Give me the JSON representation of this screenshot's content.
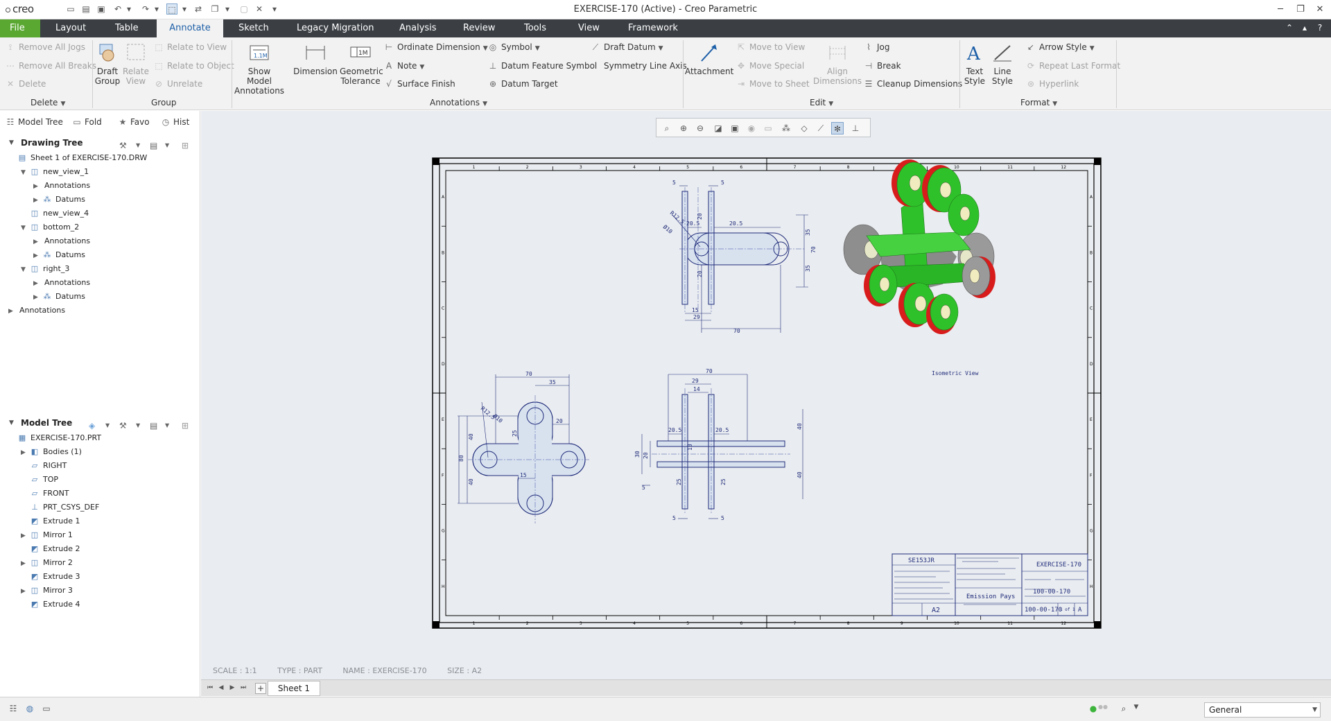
{
  "app": {
    "title": "EXERCISE-170 (Active) - Creo Parametric",
    "logo": "creo"
  },
  "menu": [
    {
      "label": "File",
      "name": "file"
    },
    {
      "label": "Layout",
      "name": "layout"
    },
    {
      "label": "Table",
      "name": "table"
    },
    {
      "label": "Annotate",
      "name": "annotate"
    },
    {
      "label": "Sketch",
      "name": "sketch"
    },
    {
      "label": "Legacy Migration",
      "name": "legacy-migration"
    },
    {
      "label": "Analysis",
      "name": "analysis"
    },
    {
      "label": "Review",
      "name": "review"
    },
    {
      "label": "Tools",
      "name": "tools"
    },
    {
      "label": "View",
      "name": "view"
    },
    {
      "label": "Framework",
      "name": "framework"
    }
  ],
  "ribbon": {
    "delete_group": {
      "remove_all_jogs": "Remove All Jogs",
      "remove_all_breaks": "Remove All Breaks",
      "delete": "Delete",
      "label": "Delete"
    },
    "group_group": {
      "draft_group": "Draft Group",
      "relate_view": "Relate View",
      "relate_to_view": "Relate to View",
      "relate_to_object": "Relate to Object",
      "unrelate": "Unrelate",
      "label": "Group"
    },
    "annotations_group": {
      "show_model_annotations": "Show Model Annotations",
      "dimension": "Dimension",
      "geometric_tolerance": "Geometric Tolerance",
      "ordinate_dimension": "Ordinate Dimension",
      "note": "Note",
      "surface_finish": "Surface Finish",
      "symbol": "Symbol",
      "datum_feature_symbol": "Datum Feature Symbol",
      "datum_target": "Datum Target",
      "draft_datum": "Draft Datum",
      "symmetry_line_axis": "Symmetry Line Axis",
      "label": "Annotations"
    },
    "edit_group": {
      "attachment": "Attachment",
      "move_to_view": "Move to View",
      "move_special": "Move Special",
      "move_to_sheet": "Move to Sheet",
      "align_dimensions": "Align Dimensions",
      "jog": "Jog",
      "break": "Break",
      "cleanup_dimensions": "Cleanup Dimensions",
      "label": "Edit"
    },
    "format_group": {
      "text_style": "Text Style",
      "line_style": "Line Style",
      "arrow_style": "Arrow Style",
      "repeat_last_format": "Repeat Last Format",
      "hyperlink": "Hyperlink",
      "label": "Format"
    }
  },
  "panel_tabs": [
    {
      "label": "Model Tree",
      "icon": "model-tree-icon"
    },
    {
      "label": "Fold",
      "icon": "folder-icon"
    },
    {
      "label": "Favo",
      "icon": "favorites-icon"
    },
    {
      "label": "Hist",
      "icon": "history-icon"
    }
  ],
  "drawing_tree": {
    "title": "Drawing Tree",
    "items": [
      {
        "label": "Sheet 1 of EXERCISE-170.DRW",
        "indent": 0,
        "toggle": "",
        "icon": "sheet-icon"
      },
      {
        "label": "new_view_1",
        "indent": 1,
        "toggle": "▼",
        "icon": "view-icon"
      },
      {
        "label": "Annotations",
        "indent": 2,
        "toggle": "▶",
        "icon": ""
      },
      {
        "label": "Datums",
        "indent": 2,
        "toggle": "▶",
        "icon": "datum-icon"
      },
      {
        "label": "new_view_4",
        "indent": 1,
        "toggle": "",
        "icon": "view-icon"
      },
      {
        "label": "bottom_2",
        "indent": 1,
        "toggle": "▼",
        "icon": "view-icon"
      },
      {
        "label": "Annotations",
        "indent": 2,
        "toggle": "▶",
        "icon": ""
      },
      {
        "label": "Datums",
        "indent": 2,
        "toggle": "▶",
        "icon": "datum-icon"
      },
      {
        "label": "right_3",
        "indent": 1,
        "toggle": "▼",
        "icon": "view-icon"
      },
      {
        "label": "Annotations",
        "indent": 2,
        "toggle": "▶",
        "icon": ""
      },
      {
        "label": "Datums",
        "indent": 2,
        "toggle": "▶",
        "icon": "datum-icon"
      },
      {
        "label": "Annotations",
        "indent": 0,
        "toggle": "▶",
        "icon": ""
      }
    ]
  },
  "model_tree": {
    "title": "Model Tree",
    "items": [
      {
        "label": "EXERCISE-170.PRT",
        "indent": 0,
        "toggle": "",
        "icon": "part-icon"
      },
      {
        "label": "Bodies (1)",
        "indent": 1,
        "toggle": "▶",
        "icon": "bodies-icon"
      },
      {
        "label": "RIGHT",
        "indent": 1,
        "toggle": "",
        "icon": "plane-icon"
      },
      {
        "label": "TOP",
        "indent": 1,
        "toggle": "",
        "icon": "plane-icon"
      },
      {
        "label": "FRONT",
        "indent": 1,
        "toggle": "",
        "icon": "plane-icon"
      },
      {
        "label": "PRT_CSYS_DEF",
        "indent": 1,
        "toggle": "",
        "icon": "csys-icon"
      },
      {
        "label": "Extrude 1",
        "indent": 1,
        "toggle": "",
        "icon": "extrude-icon"
      },
      {
        "label": "Mirror 1",
        "indent": 1,
        "toggle": "▶",
        "icon": "mirror-icon"
      },
      {
        "label": "Extrude 2",
        "indent": 1,
        "toggle": "",
        "icon": "extrude-icon"
      },
      {
        "label": "Mirror 2",
        "indent": 1,
        "toggle": "▶",
        "icon": "mirror-icon"
      },
      {
        "label": "Extrude 3",
        "indent": 1,
        "toggle": "",
        "icon": "extrude-icon"
      },
      {
        "label": "Mirror 3",
        "indent": 1,
        "toggle": "▶",
        "icon": "mirror-icon"
      },
      {
        "label": "Extrude 4",
        "indent": 1,
        "toggle": "",
        "icon": "extrude-icon"
      }
    ]
  },
  "drawing": {
    "iso_label": "Isometric View",
    "title_block": {
      "drawn": "SE153JR",
      "title": "EXERCISE-170",
      "number": "100-00-170",
      "number2": "100-00-170",
      "size": "A2",
      "sheet": "1 of 1",
      "rev": "A",
      "company": "Emission Pays"
    },
    "front_dims": [
      "5",
      "5",
      "20.5",
      "20.5",
      "20",
      "35",
      "70",
      "35",
      "20",
      "15",
      "29",
      "70"
    ],
    "bottom_dims": [
      "70",
      "35",
      "20",
      "15",
      "40",
      "80",
      "40",
      "25"
    ],
    "right_dims": [
      "70",
      "29",
      "14",
      "20.5",
      "20.5",
      "10",
      "20",
      "30",
      "40",
      "40",
      "25",
      "25",
      "5",
      "5"
    ],
    "ruler_cols": [
      "1",
      "2",
      "3",
      "4",
      "5",
      "6",
      "7",
      "8",
      "9",
      "10",
      "11",
      "12"
    ],
    "ruler_rows": [
      "A",
      "B",
      "C",
      "D",
      "E",
      "F",
      "G",
      "H"
    ]
  },
  "info": {
    "scale": "SCALE : 1:1",
    "type": "TYPE : PART",
    "name": "NAME : EXERCISE-170",
    "size": "SIZE : A2"
  },
  "sheet": {
    "tab_label": "Sheet 1"
  },
  "statusbar": {
    "filter": "General"
  },
  "colors": {
    "menubar": "#3b3f44",
    "file_green": "#5aa832",
    "accent_blue": "#1d5fa8",
    "drawing_line": "#1f2b7a",
    "model_green": "#2fc12a",
    "model_red": "#d81c1c",
    "model_gray": "#8a8a8a"
  }
}
